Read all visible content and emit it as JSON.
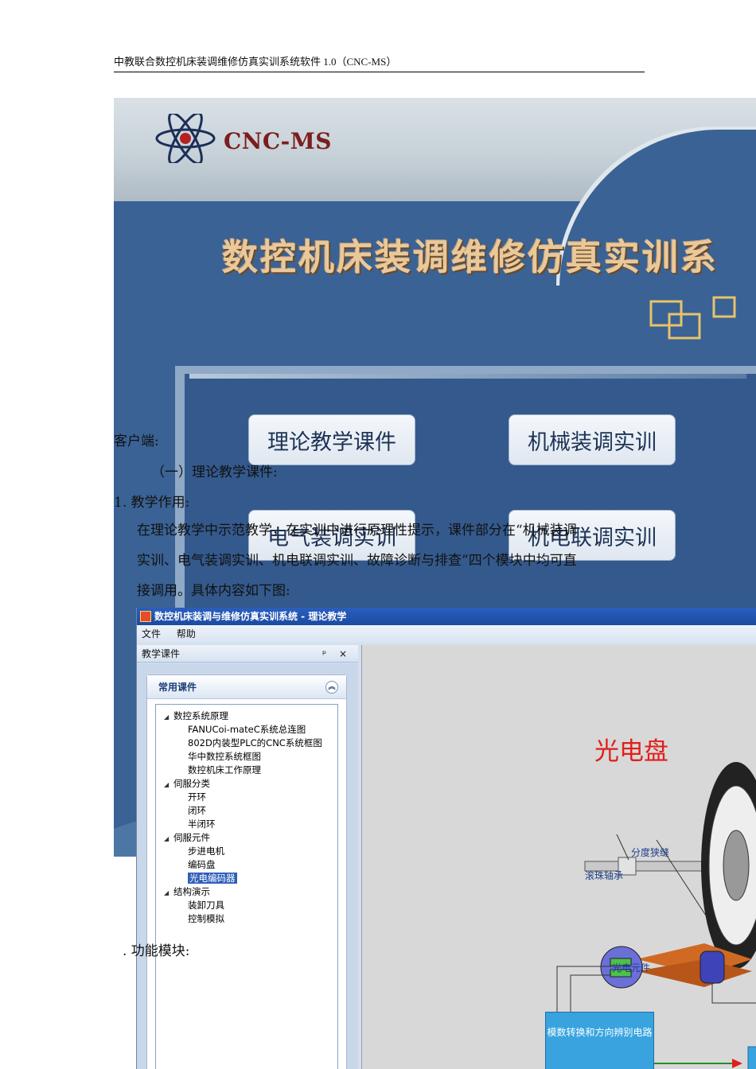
{
  "header": {
    "text": "中教联合数控机床装调维修仿真实训系统软件 1.0（CNC-MS）"
  },
  "splash": {
    "logo_text": "CNC-MS",
    "title": "数控机床装调维修仿真实训系",
    "buttons": [
      "理论教学课件",
      "机械装调实训",
      "电气装调实训",
      "机电联调实训"
    ]
  },
  "body": {
    "client": "客户端:",
    "section": "（一）理论教学课件:",
    "item1": "1.  教学作用:",
    "para_line1": "在理论教学中示范教学，在实训中进行原理性提示，课件部分在“机械装调",
    "para_line2": "实训、电气装调实训、机电联调实训、故障诊断与排查”四个模块中均可直",
    "para_line3": "接调用。具体内容如下图:",
    "item2": ".  功能模块:"
  },
  "app": {
    "title": "数控机床装调与维修仿真实训系统 - 理论教学",
    "menu": [
      "文件",
      "帮助"
    ],
    "dock_title": "教学课件",
    "dock_controls": "ᵖ ×",
    "group_title": "常用课件",
    "tree": [
      {
        "level": 0,
        "label": "数控系统原理"
      },
      {
        "level": 1,
        "label": "FANUCoi-mateC系统总连图"
      },
      {
        "level": 1,
        "label": "802D内装型PLC的CNC系统框图"
      },
      {
        "level": 1,
        "label": "华中数控系统框图"
      },
      {
        "level": 1,
        "label": "数控机床工作原理"
      },
      {
        "level": 0,
        "label": "伺服分类"
      },
      {
        "level": 1,
        "label": "开环"
      },
      {
        "level": 1,
        "label": "闭环"
      },
      {
        "level": 1,
        "label": "半闭环"
      },
      {
        "level": 0,
        "label": "伺服元件"
      },
      {
        "level": 1,
        "label": "步进电机"
      },
      {
        "level": 1,
        "label": "编码盘"
      },
      {
        "level": 1,
        "label": "光电编码器",
        "selected": true
      },
      {
        "level": 0,
        "label": "结构演示"
      },
      {
        "level": 1,
        "label": "装卸刀具"
      },
      {
        "level": 1,
        "label": "控制模拟"
      }
    ],
    "diagram": {
      "title": "光电盘",
      "label_slit": "分度狭缝",
      "label_bearing": "滚珠轴承",
      "label_photo": "光电元件",
      "box_text": "模数转换和方向辨别电路"
    }
  }
}
